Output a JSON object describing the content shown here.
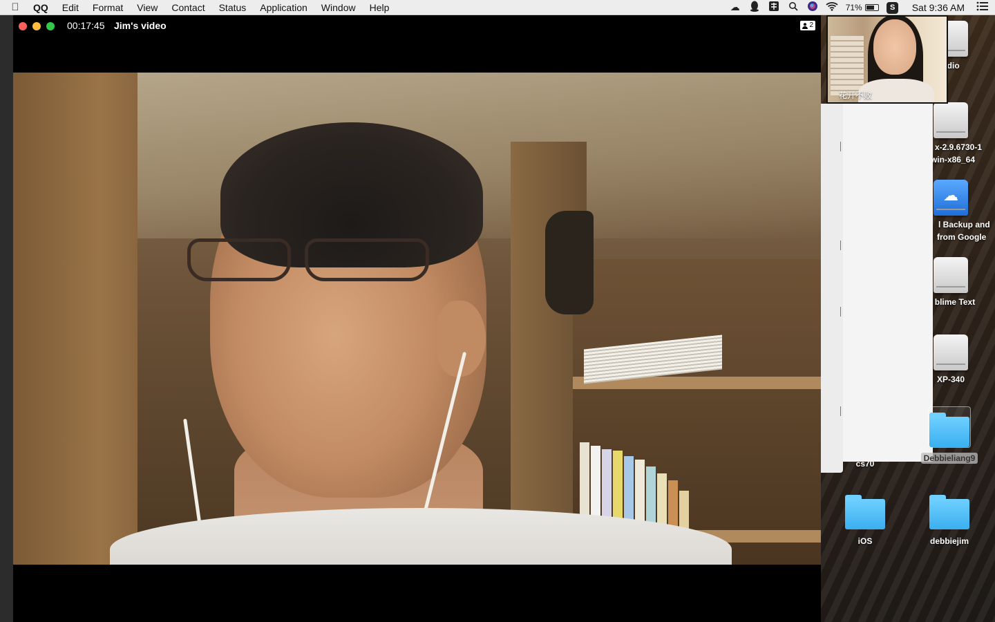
{
  "menubar": {
    "app_name": "QQ",
    "menus": [
      "Edit",
      "Format",
      "View",
      "Contact",
      "Status",
      "Application",
      "Window",
      "Help"
    ],
    "status_icons": [
      "cloud-icon",
      "qq-penguin-icon",
      "input-method-icon",
      "search-icon",
      "siri-icon",
      "wifi-icon"
    ],
    "battery_percent": "71%",
    "battery_level": 0.71,
    "clock": "Sat 9:36 AM"
  },
  "video_window": {
    "timer": "00:17:45",
    "title": "Jim's video",
    "participant_count": "2"
  },
  "self_view": {
    "name": "花开不败"
  },
  "desktop": {
    "icons": [
      {
        "label": "udio",
        "kind": "drive"
      },
      {
        "label": "x-2.9.6730-1",
        "label2": "win-x86_64",
        "kind": "drive"
      },
      {
        "label": "l Backup and",
        "label2": "from Google",
        "kind": "drive-cloud"
      },
      {
        "label": "blime Text",
        "kind": "drive"
      },
      {
        "label": "XP-340",
        "kind": "drive"
      },
      {
        "label": "cs70",
        "kind": "folder"
      },
      {
        "label": "Debbieliang9",
        "kind": "folder"
      },
      {
        "label": "iOS",
        "kind": "folder"
      },
      {
        "label": "debbiejim",
        "kind": "folder"
      }
    ]
  }
}
